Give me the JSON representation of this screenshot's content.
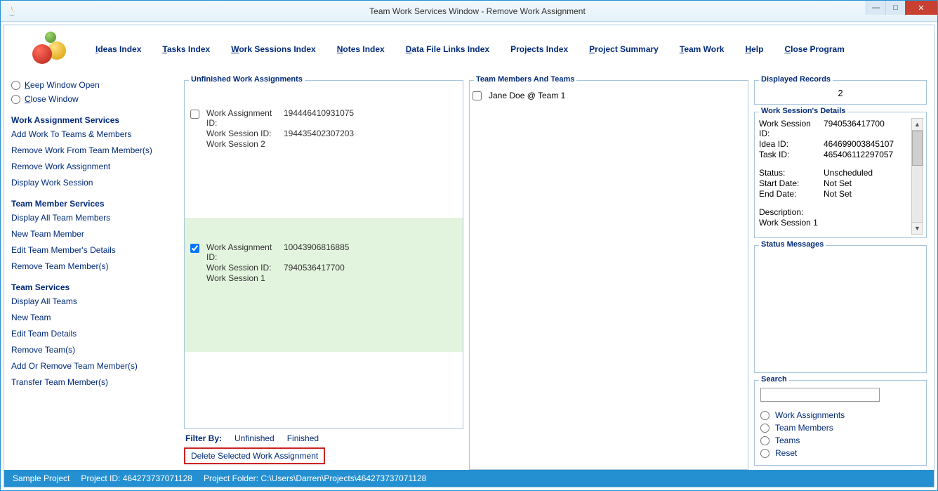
{
  "window": {
    "title": "Team Work Services Window - Remove Work Assignment"
  },
  "menu": [
    {
      "u": "I",
      "rest": "deas Index"
    },
    {
      "u": "T",
      "rest": "asks Index"
    },
    {
      "u": "W",
      "rest": "ork Sessions Index"
    },
    {
      "u": "N",
      "rest": "otes Index"
    },
    {
      "u": "D",
      "rest": "ata File Links Index"
    },
    {
      "u": "",
      "rest": "Projects Index"
    },
    {
      "u": "P",
      "rest": "roject Summary"
    },
    {
      "u": "T",
      "rest": "eam Work"
    },
    {
      "u": "H",
      "rest": "elp"
    },
    {
      "u": "C",
      "rest": "lose Program"
    }
  ],
  "left": {
    "keep": {
      "u": "K",
      "rest": "eep Window Open"
    },
    "close": {
      "u": "C",
      "rest": "lose Window"
    },
    "hdr_was": "Work Assignment Services",
    "was": [
      "Add Work To Teams & Members",
      "Remove Work From Team Member(s)",
      "Remove Work Assignment",
      "Display Work Session"
    ],
    "hdr_tms": "Team Member Services",
    "tms": [
      "Display All Team Members",
      "New Team Member",
      "Edit Team Member's Details",
      "Remove Team Member(s)"
    ],
    "hdr_ts": "Team Services",
    "ts": [
      "Display All Teams",
      "New Team",
      "Edit Team Details",
      "Remove Team(s)",
      "Add Or Remove Team Member(s)",
      "Transfer Team Member(s)"
    ]
  },
  "work": {
    "legend": "Unfinished Work Assignments",
    "items": [
      {
        "checked": false,
        "wa_lbl": "Work Assignment ID:",
        "wa_val": "194446410931075",
        "ws_lbl": "Work Session ID:",
        "ws_val": "194435402307203",
        "name": "Work Session 2"
      },
      {
        "checked": true,
        "wa_lbl": "Work Assignment ID:",
        "wa_val": "10043906816885",
        "ws_lbl": "Work Session ID:",
        "ws_val": "7940536417700",
        "name": "Work Session 1"
      }
    ],
    "filter_by": "Filter By:",
    "filter_unfinished": "Unfinished",
    "filter_finished": "Finished",
    "delete_btn": "Delete Selected Work Assignment"
  },
  "teams": {
    "legend": "Team Members And Teams",
    "items": [
      {
        "label": "Jane Doe @ Team 1"
      }
    ]
  },
  "disp": {
    "legend": "Displayed Records",
    "count": "2"
  },
  "details": {
    "legend": "Work Session's Details",
    "rows1": [
      {
        "l": "Work Session ID:",
        "v": "7940536417700"
      },
      {
        "l": "Idea ID:",
        "v": "464699003845107"
      },
      {
        "l": "Task ID:",
        "v": "465406112297057"
      }
    ],
    "rows2": [
      {
        "l": "Status:",
        "v": "Unscheduled"
      },
      {
        "l": "Start Date:",
        "v": "Not Set"
      },
      {
        "l": "End Date:",
        "v": "Not Set"
      }
    ],
    "desc_l": "Description:",
    "desc_v": "Work Session 1"
  },
  "status_legend": "Status Messages",
  "search": {
    "legend": "Search",
    "opts": [
      "Work Assignments",
      "Team Members",
      "Teams",
      "Reset"
    ]
  },
  "statusbar": {
    "project": "Sample Project",
    "pid_lbl": "Project ID: ",
    "pid": "464273737071128",
    "folder_lbl": "Project Folder: ",
    "folder": "C:\\Users\\Darren\\Projects\\464273737071128"
  }
}
